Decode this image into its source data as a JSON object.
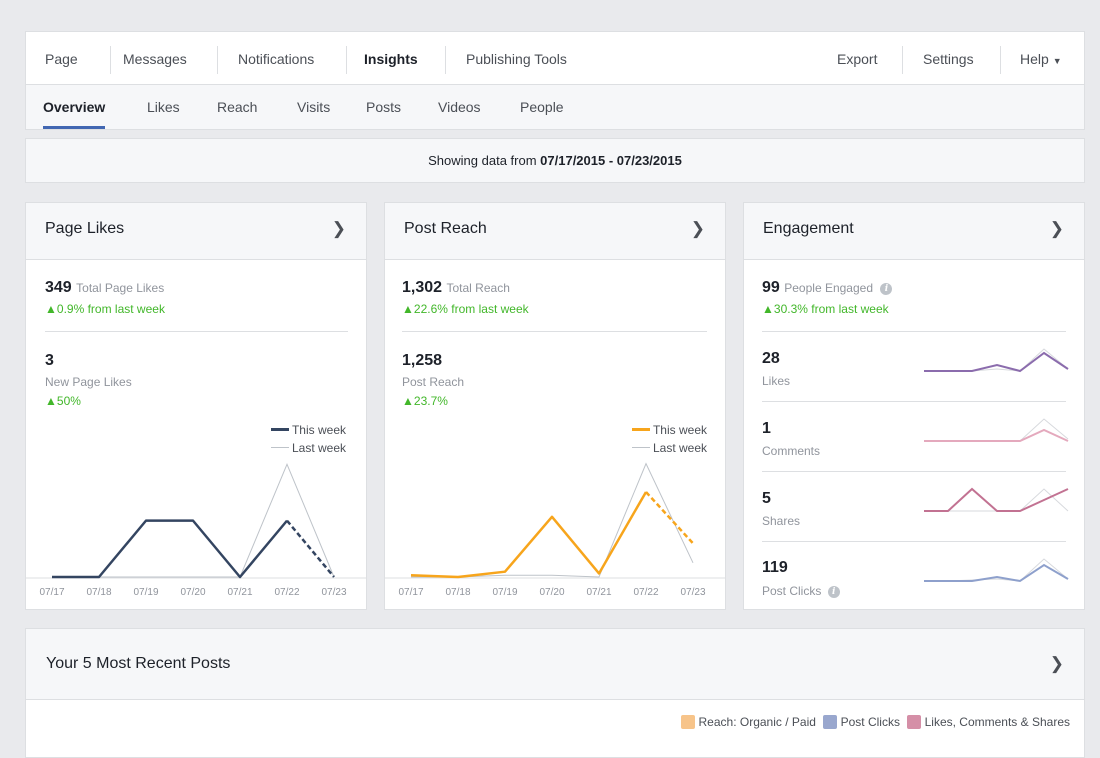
{
  "topnav": {
    "items": [
      "Page",
      "Messages",
      "Notifications",
      "Insights",
      "Publishing Tools"
    ],
    "right_items": [
      "Export",
      "Settings",
      "Help"
    ]
  },
  "subnav": {
    "items": [
      "Overview",
      "Likes",
      "Reach",
      "Visits",
      "Posts",
      "Videos",
      "People"
    ]
  },
  "range": {
    "prefix": "Showing data from ",
    "dates": "07/17/2015 - 07/23/2015"
  },
  "page_likes": {
    "title": "Page Likes",
    "total_value": "349",
    "total_label": "Total Page Likes",
    "total_change": "0.9%",
    "total_change_label": "from last week",
    "new_value": "3",
    "new_label": "New Page Likes",
    "new_change": "50%",
    "legend_this": "This week",
    "legend_last": "Last week",
    "dates": [
      "07/17",
      "07/18",
      "07/19",
      "07/20",
      "07/21",
      "07/22",
      "07/23"
    ],
    "colors": {
      "this_week": "#344561",
      "last_week": "#bec3c9"
    }
  },
  "post_reach": {
    "title": "Post Reach",
    "total_value": "1,302",
    "total_label": "Total Reach",
    "total_change": "22.6%",
    "total_change_label": "from last week",
    "new_value": "1,258",
    "new_label": "Post Reach",
    "new_change": "23.7%",
    "legend_this": "This week",
    "legend_last": "Last week",
    "dates": [
      "07/17",
      "07/18",
      "07/19",
      "07/20",
      "07/21",
      "07/22",
      "07/23"
    ],
    "colors": {
      "this_week": "#f7a51c",
      "last_week": "#bec3c9"
    }
  },
  "engagement": {
    "title": "Engagement",
    "total_value": "99",
    "total_label": "People Engaged",
    "total_change": "30.3%",
    "total_change_label": "from last week",
    "metrics": [
      {
        "value": "28",
        "label": "Likes",
        "color": "#8b6cad"
      },
      {
        "value": "1",
        "label": "Comments",
        "color": "#e4a9bd"
      },
      {
        "value": "5",
        "label": "Shares",
        "color": "#c27292"
      },
      {
        "value": "119",
        "label": "Post Clicks",
        "color": "#8ea0cc"
      }
    ]
  },
  "recent": {
    "title": "Your 5 Most Recent Posts",
    "legend": [
      {
        "label": "Reach: Organic / Paid",
        "color": "#f7c48a"
      },
      {
        "label": "Post Clicks",
        "color": "#99a7ce"
      },
      {
        "label": "Likes, Comments & Shares",
        "color": "#d58fa7"
      }
    ]
  },
  "chart_data": [
    {
      "type": "line",
      "title": "Page Likes",
      "x": [
        "07/17",
        "07/18",
        "07/19",
        "07/20",
        "07/21",
        "07/22",
        "07/23"
      ],
      "series": [
        {
          "name": "This week",
          "values": [
            0,
            0,
            1,
            1,
            0,
            1,
            0
          ]
        },
        {
          "name": "Last week",
          "values": [
            0,
            0,
            0,
            0,
            0,
            2,
            0
          ]
        }
      ],
      "ylim": [
        0,
        2.2
      ]
    },
    {
      "type": "line",
      "title": "Post Reach",
      "x": [
        "07/17",
        "07/18",
        "07/19",
        "07/20",
        "07/21",
        "07/22",
        "07/23"
      ],
      "series": [
        {
          "name": "This week",
          "values": [
            10,
            0,
            30,
            340,
            20,
            480,
            190
          ]
        },
        {
          "name": "Last week",
          "values": [
            0,
            0,
            10,
            10,
            0,
            640,
            80
          ]
        }
      ],
      "ylim": [
        0,
        700
      ]
    }
  ]
}
